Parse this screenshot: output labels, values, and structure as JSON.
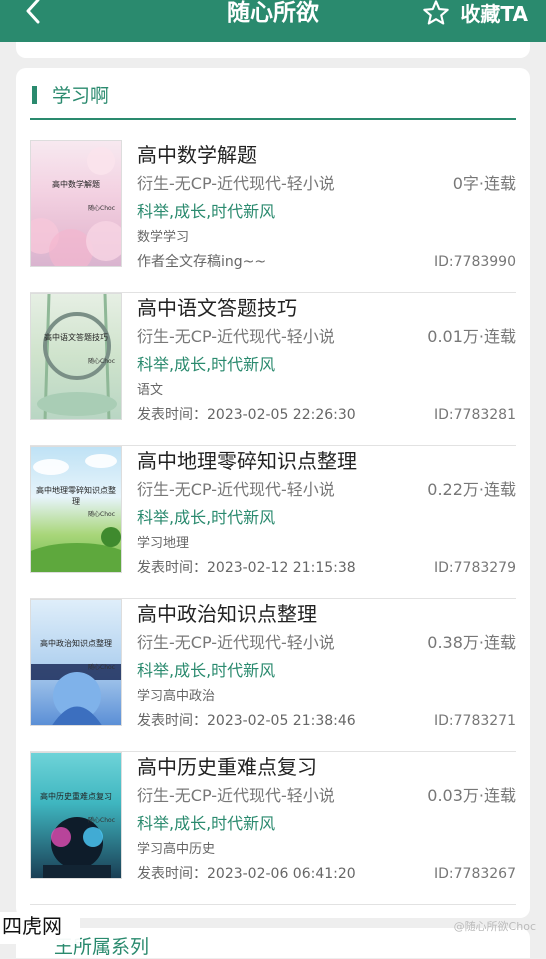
{
  "header": {
    "title": "随心所欲",
    "favorite_label": "收藏TA",
    "color": "#2a8a6e"
  },
  "section": {
    "title": "学习啊"
  },
  "books": [
    {
      "title": "高中数学解题",
      "genre": "衍生-无CP-近代现代-轻小说",
      "count": "0字·连载",
      "tags": "科举,成长,时代新风",
      "desc": "数学学习",
      "meta": "作者全文存稿ing~~",
      "id": "ID:7783990",
      "cover": {
        "title": "高中数学解题",
        "author": "随心Choc",
        "theme": "sakura"
      }
    },
    {
      "title": "高中语文答题技巧",
      "genre": "衍生-无CP-近代现代-轻小说",
      "count": "0.01万·连载",
      "tags": "科举,成长,时代新风",
      "desc": "语文",
      "meta": "发表时间：2023-02-05 22:26:30",
      "id": "ID:7783281",
      "cover": {
        "title": "高中语文答题技巧",
        "author": "随心Choc",
        "theme": "bamboo"
      }
    },
    {
      "title": "高中地理零碎知识点整理",
      "genre": "衍生-无CP-近代现代-轻小说",
      "count": "0.22万·连载",
      "tags": "科举,成长,时代新风",
      "desc": "学习地理",
      "meta": "发表时间：2023-02-12 21:15:38",
      "id": "ID:7783279",
      "cover": {
        "title": "高中地理零碎知识点整理",
        "author": "随心Choc",
        "theme": "meadow"
      }
    },
    {
      "title": "高中政治知识点整理",
      "genre": "衍生-无CP-近代现代-轻小说",
      "count": "0.38万·连载",
      "tags": "科举,成长,时代新风",
      "desc": "学习高中政治",
      "meta": "发表时间：2023-02-05 21:38:46",
      "id": "ID:7783271",
      "cover": {
        "title": "高中政治知识点整理",
        "author": "随心Choc",
        "theme": "anime"
      }
    },
    {
      "title": "高中历史重难点复习",
      "genre": "衍生-无CP-近代现代-轻小说",
      "count": "0.03万·连载",
      "tags": "科举,成长,时代新风",
      "desc": "学习高中历史",
      "meta": "发表时间：2023-02-06 06:41:20",
      "id": "ID:7783267",
      "cover": {
        "title": "高中历史重难点复习",
        "author": "随心Choc",
        "theme": "neon"
      }
    }
  ],
  "next_section": {
    "title": "王所属系列"
  },
  "watermark": "四虎网",
  "weibo_mark": "@随心所欲Choc"
}
